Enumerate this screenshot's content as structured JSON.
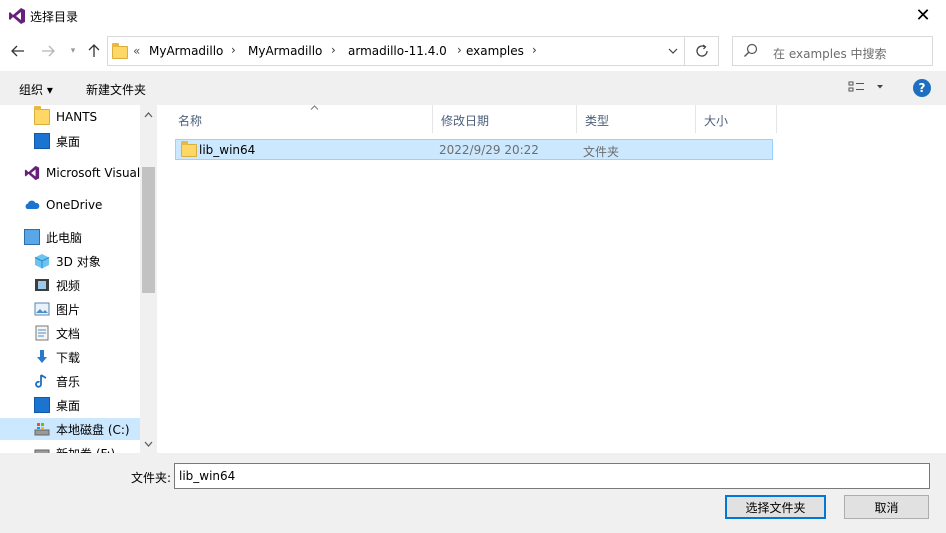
{
  "window": {
    "title": "选择目录"
  },
  "address": {
    "overflow": "«",
    "crumbs": [
      "MyArmadillo",
      "MyArmadillo",
      "armadillo-11.4.0",
      "examples"
    ]
  },
  "search": {
    "placeholder": "在 examples 中搜索"
  },
  "toolbar": {
    "organize": "组织 ▾",
    "new_folder": "新建文件夹"
  },
  "sidebar": {
    "items": [
      {
        "label": "HANTS",
        "icon": "folder-icon"
      },
      {
        "label": "桌面",
        "icon": "desktop-icon"
      },
      {
        "label": "Microsoft Visual",
        "icon": "visual-studio-icon"
      },
      {
        "label": "OneDrive",
        "icon": "cloud-icon"
      },
      {
        "label": "此电脑",
        "icon": "computer-icon"
      },
      {
        "label": "3D 对象",
        "icon": "cube-icon"
      },
      {
        "label": "视频",
        "icon": "video-icon"
      },
      {
        "label": "图片",
        "icon": "picture-icon"
      },
      {
        "label": "文档",
        "icon": "document-icon"
      },
      {
        "label": "下载",
        "icon": "download-icon"
      },
      {
        "label": "音乐",
        "icon": "music-icon"
      },
      {
        "label": "桌面",
        "icon": "desktop-icon"
      },
      {
        "label": "本地磁盘 (C:)",
        "icon": "drive-icon"
      },
      {
        "label": "新加卷 (F:)",
        "icon": "drive-icon"
      }
    ]
  },
  "columns": {
    "name": "名称",
    "modified": "修改日期",
    "type": "类型",
    "size": "大小"
  },
  "files": [
    {
      "name": "lib_win64",
      "modified": "2022/9/29 20:22",
      "type": "文件夹",
      "size": ""
    }
  ],
  "footer": {
    "field_label": "文件夹:",
    "field_value": "lib_win64",
    "select_button": "选择文件夹",
    "cancel_button": "取消"
  },
  "colors": {
    "selection": "#cce8ff",
    "accent": "#0078d7",
    "vs_purple": "#68217a"
  }
}
